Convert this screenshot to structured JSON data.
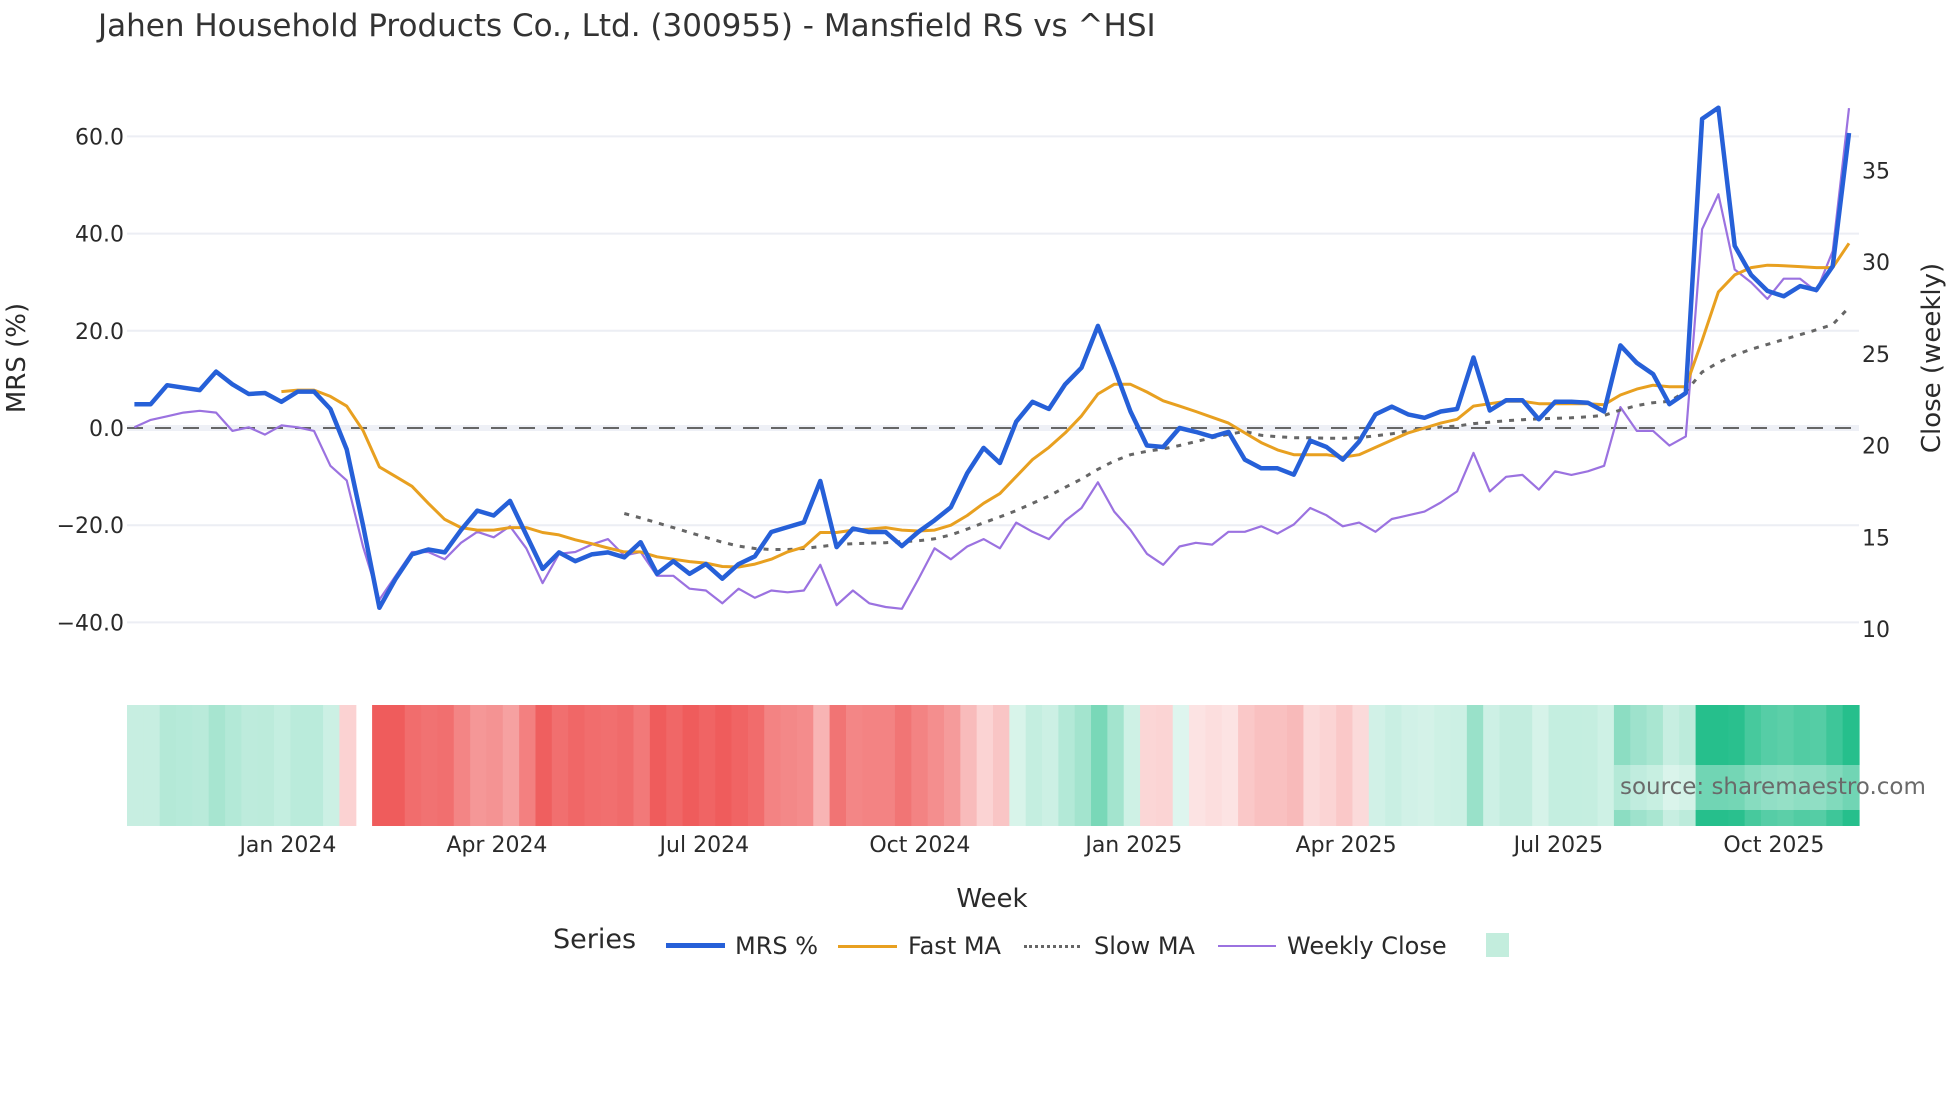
{
  "title": "Jahen Household Products Co., Ltd. (300955) - Mansfield RS vs ^HSI",
  "source": "source: sharemaestro.com",
  "colors": {
    "mrs": "#2660d8",
    "fast_ma": "#e8a020",
    "slow_ma": "#666666",
    "close": "#9b72e0",
    "heat_pos": "#26bf8c",
    "heat_neg": "#ef5c5c"
  },
  "chart_data": {
    "type": "line",
    "title": "Jahen Household Products Co., Ltd. (300955) - Mansfield RS vs ^HSI",
    "xlabel": "Week",
    "ylabel": "MRS (%)",
    "y2label": "Close (weekly)",
    "ylim": [
      -50,
      72
    ],
    "y2lim": [
      6.5,
      40
    ],
    "yticks": [
      "60.0",
      "40.0",
      "20.0",
      "0.0",
      "−20.0",
      "−40.0"
    ],
    "ytick_values": [
      60,
      40,
      20,
      0,
      -20,
      -40
    ],
    "y2ticks": [
      "35",
      "30",
      "25",
      "20",
      "15",
      "10"
    ],
    "y2tick_values": [
      35,
      30,
      25,
      20,
      15,
      10
    ],
    "xticks": [
      "Jan 2024",
      "Apr 2024",
      "Jul 2024",
      "Oct 2024",
      "Jan 2025",
      "Apr 2025",
      "Jul 2025",
      "Oct 2025"
    ],
    "xtick_week_index": [
      9.4,
      22.2,
      34.9,
      48.1,
      61.2,
      74.2,
      87.2,
      100.4
    ],
    "legend": {
      "title": "Series",
      "placement": "bottom",
      "entries": [
        "MRS %",
        "Fast MA",
        "Slow MA",
        "Weekly Close"
      ]
    },
    "grid": true,
    "zero_line": 0,
    "series": [
      {
        "name": "MRS %",
        "axis": "left",
        "values": [
          4.9,
          4.9,
          8.8,
          8.3,
          7.8,
          11.6,
          9,
          7,
          7.2,
          5.4,
          7.5,
          7.5,
          3.9,
          -4.4,
          -20,
          -37,
          -31,
          -26,
          -25,
          -25.6,
          -21,
          -17,
          -18,
          -15,
          -22,
          -29,
          -25.6,
          -27.4,
          -26,
          -25.6,
          -26.6,
          -23.5,
          -30,
          -27.4,
          -30,
          -28,
          -31,
          -28,
          -26.4,
          -21.4,
          -20.4,
          -19.4,
          -10.9,
          -24.5,
          -20.7,
          -21.4,
          -21.4,
          -24.3,
          -21.4,
          -19,
          -16.3,
          -9.3,
          -4.1,
          -7.2,
          1.3,
          5.4,
          3.9,
          9,
          12.4,
          21,
          12.4,
          3.4,
          -3.6,
          -3.9,
          0,
          -0.8,
          -1.8,
          -0.8,
          -6.5,
          -8.3,
          -8.3,
          -9.6,
          -2.6,
          -3.9,
          -6.5,
          -2.8,
          2.8,
          4.4,
          2.8,
          2.1,
          3.4,
          3.9,
          14.5,
          3.6,
          5.7,
          5.7,
          1.8,
          5.4,
          5.4,
          5.2,
          3.4,
          17,
          13.4,
          11.1,
          4.9,
          7.2,
          63.6,
          65.9,
          37.5,
          31.5,
          28.2,
          27.1,
          29.2,
          28.4,
          33.3,
          60.7
        ]
      },
      {
        "name": "Fast MA",
        "axis": "left",
        "values": [
          null,
          null,
          null,
          null,
          null,
          null,
          null,
          null,
          null,
          7.5,
          7.8,
          7.8,
          6.5,
          4.5,
          -0.5,
          -8,
          -10,
          -12,
          -15.5,
          -18.8,
          -20.5,
          -21,
          -21,
          -20.5,
          -20.5,
          -21.5,
          -22,
          -23,
          -23.8,
          -24.7,
          -25.5,
          -25.5,
          -26.5,
          -27,
          -27.5,
          -27.8,
          -28.5,
          -28.6,
          -28,
          -27,
          -25.5,
          -24.5,
          -21.5,
          -21.5,
          -21,
          -20.8,
          -20.5,
          -21,
          -21.2,
          -21,
          -20,
          -18,
          -15.5,
          -13.5,
          -10,
          -6.5,
          -4,
          -1,
          2.5,
          7,
          9,
          9,
          7.4,
          5.6,
          4.5,
          3.4,
          2.2,
          1,
          -1,
          -3,
          -4.5,
          -5.5,
          -5.5,
          -5.5,
          -6,
          -5.5,
          -4,
          -2.5,
          -1,
          0,
          1,
          1.8,
          4.5,
          5,
          5.5,
          5.5,
          5,
          5,
          5,
          5,
          4.8,
          6.8,
          8,
          8.8,
          8.5,
          8.5,
          18,
          28,
          31.5,
          33,
          33.5,
          33.4,
          33.2,
          33,
          33,
          38
        ]
      },
      {
        "name": "Slow MA",
        "axis": "left",
        "values": [
          null,
          null,
          null,
          null,
          null,
          null,
          null,
          null,
          null,
          null,
          null,
          null,
          null,
          null,
          null,
          null,
          null,
          null,
          null,
          null,
          null,
          null,
          null,
          null,
          null,
          null,
          null,
          null,
          null,
          null,
          -17.6,
          -18.5,
          -19.5,
          -20.5,
          -21.5,
          -22.5,
          -23.5,
          -24.3,
          -24.8,
          -25,
          -25,
          -24.8,
          -24.4,
          -24,
          -23.8,
          -23.7,
          -23.6,
          -23.4,
          -23.2,
          -22.8,
          -22,
          -20.8,
          -19.5,
          -18.3,
          -17,
          -15.5,
          -14,
          -12.2,
          -10.5,
          -8.5,
          -6.8,
          -5.5,
          -4.8,
          -4.3,
          -3.6,
          -2.8,
          -2,
          -1.3,
          -0.7,
          -1.5,
          -1.8,
          -2,
          -2,
          -2.1,
          -2.1,
          -2,
          -1.6,
          -1.2,
          -0.6,
          -0.2,
          0.2,
          0.4,
          0.9,
          1.2,
          1.5,
          1.7,
          1.9,
          2,
          2.1,
          2.3,
          2.6,
          3.7,
          4.6,
          5.2,
          5.5,
          7.5,
          11.5,
          13.5,
          15,
          16.2,
          17.2,
          18.2,
          19.2,
          20.2,
          21.3,
          24.8
        ]
      },
      {
        "name": "Weekly Close",
        "axis": "right",
        "values": [
          21,
          21.4,
          21.6,
          21.8,
          21.9,
          21.8,
          20.8,
          21,
          20.6,
          21.1,
          21,
          20.8,
          18.9,
          18.1,
          14.5,
          11.6,
          12.9,
          14.2,
          14.2,
          13.8,
          14.7,
          15.3,
          15,
          15.6,
          14.4,
          12.5,
          14.1,
          14.2,
          14.6,
          14.9,
          14,
          14.2,
          12.9,
          12.9,
          12.2,
          12.1,
          11.4,
          12.2,
          11.7,
          12.1,
          12,
          12.1,
          13.5,
          11.3,
          12.1,
          11.4,
          11.2,
          11.1,
          12.7,
          14.4,
          13.8,
          14.5,
          14.9,
          14.4,
          15.8,
          15.3,
          14.9,
          15.9,
          16.6,
          18,
          16.4,
          15.4,
          14.1,
          13.5,
          14.5,
          14.7,
          14.6,
          15.3,
          15.3,
          15.6,
          15.2,
          15.7,
          16.6,
          16.2,
          15.6,
          15.8,
          15.3,
          16,
          16.2,
          16.4,
          16.9,
          17.5,
          19.6,
          17.5,
          18.3,
          18.4,
          17.6,
          18.6,
          18.4,
          18.6,
          18.9,
          22.1,
          20.8,
          20.8,
          20,
          20.5,
          31.8,
          33.7,
          29.6,
          28.9,
          28,
          29.1,
          29.1,
          28.4,
          30.6,
          38.4
        ]
      }
    ],
    "heatmap": {
      "source_series": "MRS %",
      "missing_week_index": [
        14
      ]
    }
  }
}
